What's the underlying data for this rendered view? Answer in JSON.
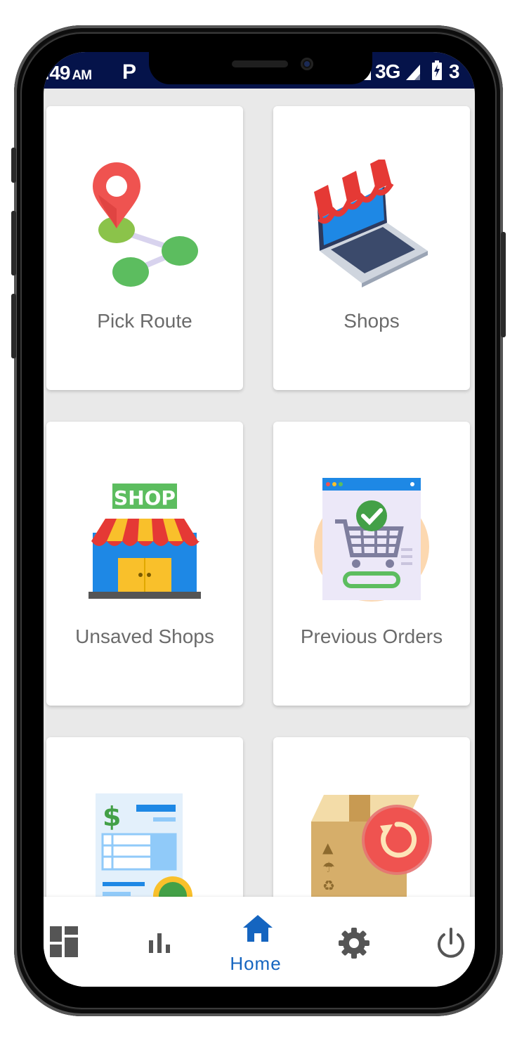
{
  "status_bar": {
    "time": ":49",
    "ampm": "AM",
    "app_indicator": "P",
    "network": "3G",
    "battery": "3"
  },
  "cards": [
    {
      "label": "Pick Route",
      "icon": "map-route-icon"
    },
    {
      "label": "Shops",
      "icon": "laptop-shop-icon"
    },
    {
      "label": "Unsaved Shops",
      "icon": "storefront-icon"
    },
    {
      "label": "Previous Orders",
      "icon": "cart-order-icon"
    },
    {
      "label": "",
      "icon": "invoice-icon"
    },
    {
      "label": "",
      "icon": "return-box-icon"
    }
  ],
  "bottom_nav": {
    "items": [
      {
        "icon": "dashboard-icon"
      },
      {
        "icon": "bar-chart-icon"
      },
      {
        "icon": "home-icon",
        "label": "Home",
        "active": true
      },
      {
        "icon": "gear-icon"
      },
      {
        "icon": "power-icon"
      }
    ]
  },
  "colors": {
    "status_bar": "#05134a",
    "accent": "#1565c0",
    "background": "#e9e9e9"
  }
}
